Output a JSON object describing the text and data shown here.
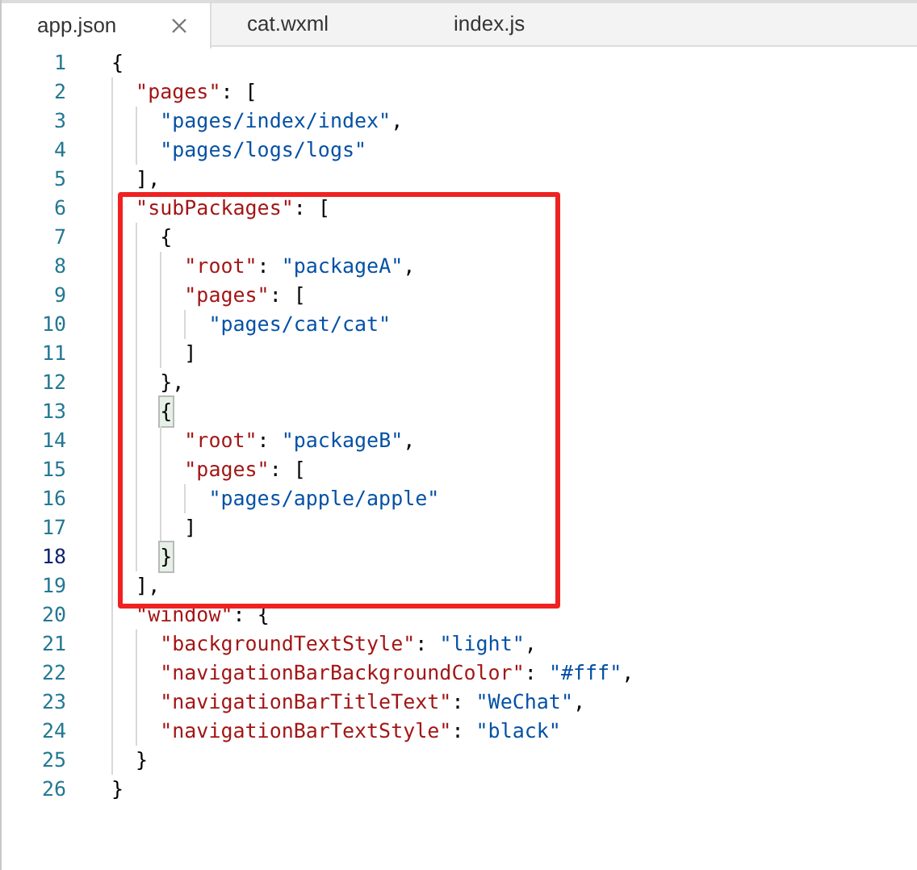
{
  "tabs": [
    {
      "label": "app.json",
      "selected": true,
      "closable": true
    },
    {
      "label": "cat.wxml",
      "selected": false,
      "closable": false
    },
    {
      "label": "index.js",
      "selected": false,
      "closable": false
    }
  ],
  "editor": {
    "lines": [
      {
        "number": "1",
        "current": false,
        "tokens": [
          {
            "kind": "punct",
            "text": "{"
          }
        ]
      },
      {
        "number": "2",
        "current": false,
        "tokens": [
          {
            "kind": "key",
            "text": "  \"pages\""
          },
          {
            "kind": "punct",
            "text": ": ["
          }
        ]
      },
      {
        "number": "3",
        "current": false,
        "tokens": [
          {
            "kind": "string",
            "text": "    \"pages/index/index\""
          },
          {
            "kind": "punct",
            "text": ","
          }
        ]
      },
      {
        "number": "4",
        "current": false,
        "tokens": [
          {
            "kind": "string",
            "text": "    \"pages/logs/logs\""
          }
        ]
      },
      {
        "number": "5",
        "current": false,
        "tokens": [
          {
            "kind": "punct",
            "text": "  ],"
          }
        ]
      },
      {
        "number": "6",
        "current": false,
        "tokens": [
          {
            "kind": "key",
            "text": "  \"subPackages\""
          },
          {
            "kind": "punct",
            "text": ": ["
          }
        ]
      },
      {
        "number": "7",
        "current": false,
        "tokens": [
          {
            "kind": "punct",
            "text": "    {"
          }
        ]
      },
      {
        "number": "8",
        "current": false,
        "tokens": [
          {
            "kind": "key",
            "text": "      \"root\""
          },
          {
            "kind": "punct",
            "text": ": "
          },
          {
            "kind": "string",
            "text": "\"packageA\""
          },
          {
            "kind": "punct",
            "text": ","
          }
        ]
      },
      {
        "number": "9",
        "current": false,
        "tokens": [
          {
            "kind": "key",
            "text": "      \"pages\""
          },
          {
            "kind": "punct",
            "text": ": ["
          }
        ]
      },
      {
        "number": "10",
        "current": false,
        "tokens": [
          {
            "kind": "string",
            "text": "        \"pages/cat/cat\""
          }
        ]
      },
      {
        "number": "11",
        "current": false,
        "tokens": [
          {
            "kind": "punct",
            "text": "      ]"
          }
        ]
      },
      {
        "number": "12",
        "current": false,
        "tokens": [
          {
            "kind": "punct",
            "text": "    },"
          }
        ]
      },
      {
        "number": "13",
        "current": false,
        "tokens": [
          {
            "kind": "punct",
            "text": "    {",
            "matched": true
          }
        ]
      },
      {
        "number": "14",
        "current": false,
        "tokens": [
          {
            "kind": "key",
            "text": "      \"root\""
          },
          {
            "kind": "punct",
            "text": ": "
          },
          {
            "kind": "string",
            "text": "\"packageB\""
          },
          {
            "kind": "punct",
            "text": ","
          }
        ]
      },
      {
        "number": "15",
        "current": false,
        "tokens": [
          {
            "kind": "key",
            "text": "      \"pages\""
          },
          {
            "kind": "punct",
            "text": ": ["
          }
        ]
      },
      {
        "number": "16",
        "current": false,
        "tokens": [
          {
            "kind": "string",
            "text": "        \"pages/apple/apple\""
          }
        ]
      },
      {
        "number": "17",
        "current": false,
        "tokens": [
          {
            "kind": "punct",
            "text": "      ]"
          }
        ]
      },
      {
        "number": "18",
        "current": true,
        "tokens": [
          {
            "kind": "punct",
            "text": "    }",
            "matched": true
          }
        ]
      },
      {
        "number": "19",
        "current": false,
        "tokens": [
          {
            "kind": "punct",
            "text": "  ],"
          }
        ]
      },
      {
        "number": "20",
        "current": false,
        "tokens": [
          {
            "kind": "key",
            "text": "  \"window\""
          },
          {
            "kind": "punct",
            "text": ": {"
          }
        ]
      },
      {
        "number": "21",
        "current": false,
        "tokens": [
          {
            "kind": "key",
            "text": "    \"backgroundTextStyle\""
          },
          {
            "kind": "punct",
            "text": ": "
          },
          {
            "kind": "string",
            "text": "\"light\""
          },
          {
            "kind": "punct",
            "text": ","
          }
        ]
      },
      {
        "number": "22",
        "current": false,
        "tokens": [
          {
            "kind": "key",
            "text": "    \"navigationBarBackgroundColor\""
          },
          {
            "kind": "punct",
            "text": ": "
          },
          {
            "kind": "string",
            "text": "\"#fff\""
          },
          {
            "kind": "punct",
            "text": ","
          }
        ]
      },
      {
        "number": "23",
        "current": false,
        "tokens": [
          {
            "kind": "key",
            "text": "    \"navigationBarTitleText\""
          },
          {
            "kind": "punct",
            "text": ": "
          },
          {
            "kind": "string",
            "text": "\"WeChat\""
          },
          {
            "kind": "punct",
            "text": ","
          }
        ]
      },
      {
        "number": "24",
        "current": false,
        "tokens": [
          {
            "kind": "key",
            "text": "    \"navigationBarTextStyle\""
          },
          {
            "kind": "punct",
            "text": ": "
          },
          {
            "kind": "string",
            "text": "\"black\""
          }
        ]
      },
      {
        "number": "25",
        "current": false,
        "tokens": [
          {
            "kind": "punct",
            "text": "  }"
          }
        ]
      },
      {
        "number": "26",
        "current": false,
        "tokens": [
          {
            "kind": "punct",
            "text": "}"
          }
        ]
      }
    ],
    "highlight": {
      "visible": true
    }
  }
}
